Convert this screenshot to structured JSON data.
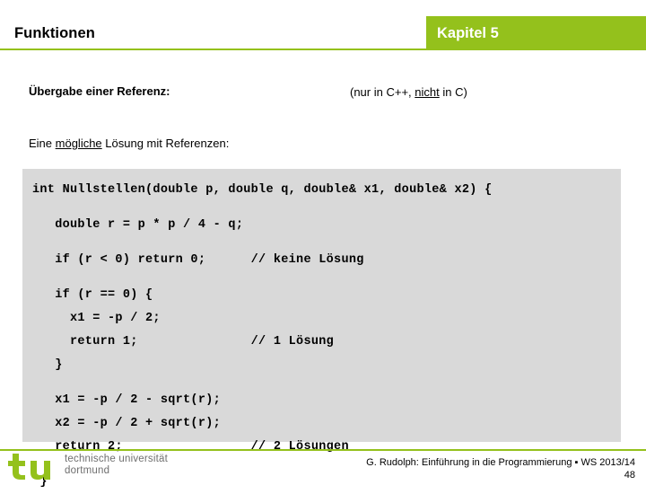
{
  "header": {
    "title": "Funktionen",
    "chapter": "Kapitel 5",
    "accent_color": "#94c11c"
  },
  "content": {
    "heading": "Übergabe einer Referenz:",
    "note_prefix": "(nur in C++, ",
    "note_underlined": "nicht",
    "note_suffix": " in C)",
    "subheading_prefix": "Eine ",
    "subheading_underlined": "mögliche",
    "subheading_suffix": " Lösung mit Referenzen:"
  },
  "code": {
    "background_color": "#d9d9d9",
    "lines": [
      "int Nullstellen(double p, double q, double& x1, double& x2) {",
      "",
      "   double r = p * p / 4 - q;",
      "",
      "   if (r < 0) return 0;      // keine Lösung",
      "",
      "   if (r == 0) {",
      "     x1 = -p / 2;",
      "     return 1;               // 1 Lösung",
      "   }",
      "",
      "   x1 = -p / 2 - sqrt(r);",
      "   x2 = -p / 2 + sqrt(r);",
      "   return 2;                 // 2 Lösungen",
      "",
      " }"
    ]
  },
  "footer": {
    "logo_mark": "tu",
    "logo_line1": "technische universität",
    "logo_line2": "dortmund",
    "credit": "G. Rudolph: Einführung in die Programmierung ▪ WS 2013/14",
    "page_number": "48"
  }
}
